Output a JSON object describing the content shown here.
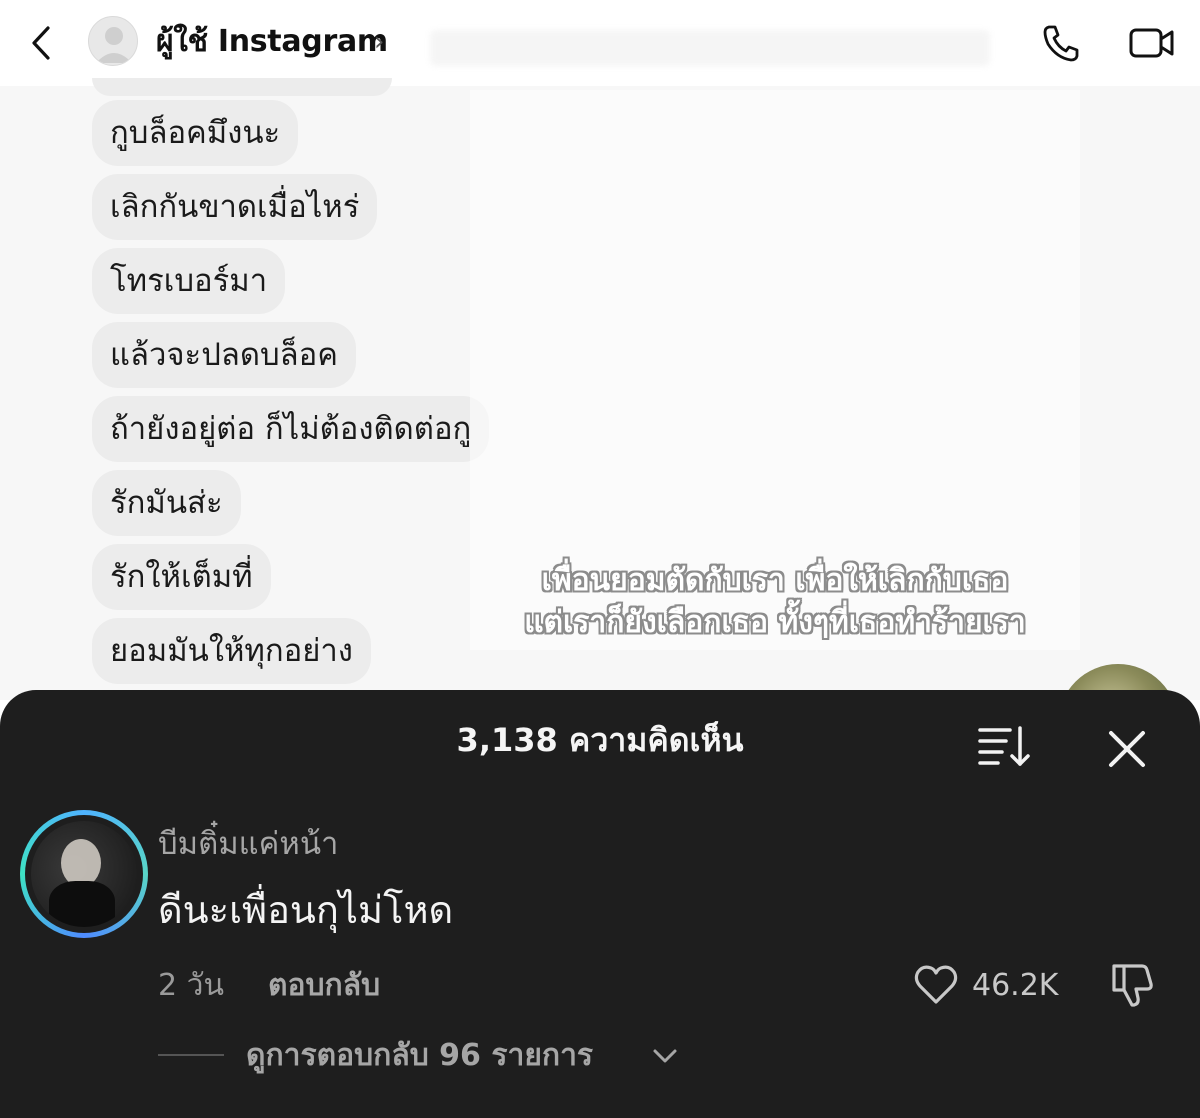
{
  "chat": {
    "header": {
      "name": "ผู้ใช้ Instagram",
      "chevron": "›"
    },
    "messages": [
      "กูบล็อคมึงนะ",
      "เลิกกันขาดเมื่อไหร่",
      "โทรเบอร์มา",
      "แล้วจะปลดบล็อค",
      "ถ้ายังอยู่ต่อ ก็ไม่ต้องติดต่อกู",
      "รักมันส่ะ",
      "รักให้เต็มที่",
      "ยอมมันให้ทุกอย่าง"
    ],
    "caption": {
      "line1": "เพื่อนยอมตัดกับเรา เพื่อให้เลิกกับเธอ",
      "line2": "แต่เราก็ยังเลือกเธอ ทั้งๆที่เธอทำร้ายเรา"
    }
  },
  "comments": {
    "title": "3,138 ความคิดเห็น",
    "items": [
      {
        "username": "บีมติ๋มแค่หน้า",
        "text": "ดีนะเพื่อนกุไม่โหด",
        "time": "2 วัน",
        "reply_label": "ตอบกลับ",
        "likes": "46.2K",
        "view_replies": "ดูการตอบกลับ 96 รายการ"
      }
    ]
  },
  "icons": {
    "back": "back-chevron-icon",
    "phone": "phone-icon",
    "video": "video-camera-icon",
    "sort": "sort-icon",
    "close": "close-icon",
    "heart": "heart-icon",
    "dislike": "thumbs-down-icon",
    "chevron_down": "chevron-down-icon"
  },
  "colors": {
    "sheet_bg": "#1e1e1e",
    "bubble_bg": "#ececec",
    "avatar_ring": "#4fb3ff"
  }
}
